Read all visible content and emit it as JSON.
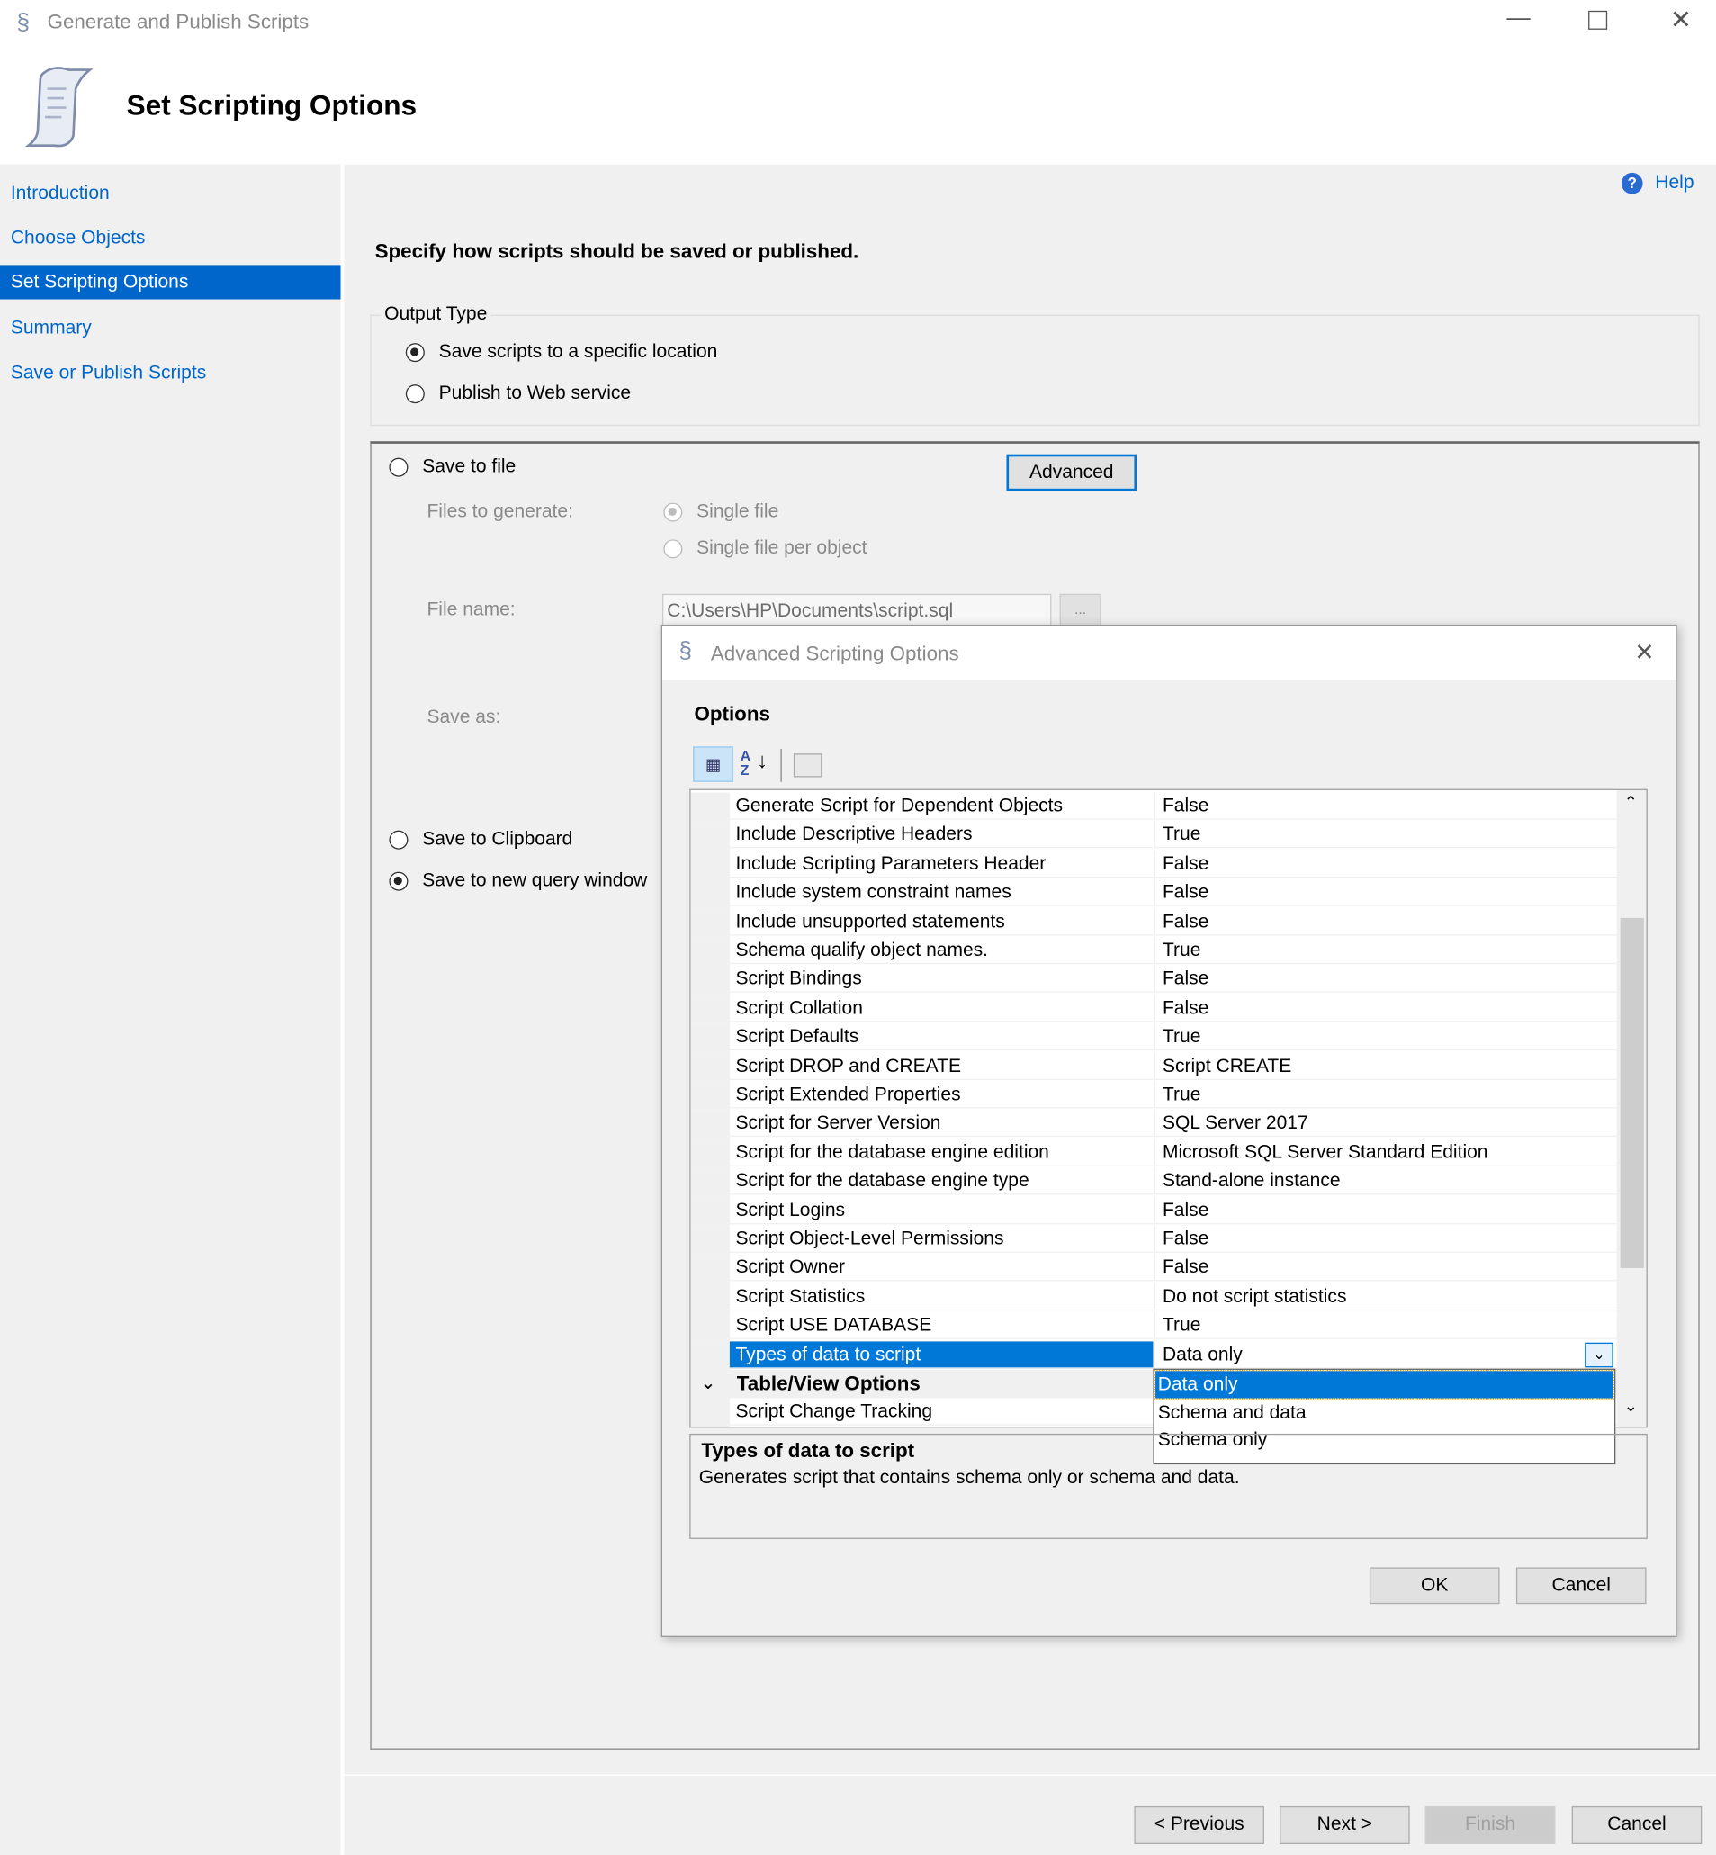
{
  "window": {
    "title": "Generate and Publish Scripts"
  },
  "header": {
    "title": "Set Scripting Options"
  },
  "sidebar": {
    "items": [
      {
        "label": "Introduction"
      },
      {
        "label": "Choose Objects"
      },
      {
        "label": "Set Scripting Options",
        "selected": true
      },
      {
        "label": "Summary"
      },
      {
        "label": "Save or Publish Scripts"
      }
    ]
  },
  "help": "Help",
  "instruction": "Specify how scripts should be saved or published.",
  "output_type": {
    "label": "Output Type",
    "options": [
      "Save scripts to a specific location",
      "Publish to Web service"
    ],
    "selected": 0
  },
  "save": {
    "save_to_file": "Save to file",
    "advanced": "Advanced",
    "files_label": "Files to generate:",
    "single_file": "Single file",
    "per_object": "Single file per object",
    "file_name_label": "File name:",
    "file_name": "C:\\Users\\HP\\Documents\\script.sql",
    "browse": "...",
    "save_as_label": "Save as:",
    "clipboard": "Save to Clipboard",
    "query_window": "Save to new query window",
    "selected": "query_window"
  },
  "dialog": {
    "title": "Advanced Scripting Options",
    "options_label": "Options",
    "rows": [
      {
        "name": "Generate Script for Dependent Objects",
        "value": "False"
      },
      {
        "name": "Include Descriptive Headers",
        "value": "True"
      },
      {
        "name": "Include Scripting Parameters Header",
        "value": "False"
      },
      {
        "name": "Include system constraint names",
        "value": "False"
      },
      {
        "name": "Include unsupported statements",
        "value": "False"
      },
      {
        "name": "Schema qualify object names.",
        "value": "True"
      },
      {
        "name": "Script Bindings",
        "value": "False"
      },
      {
        "name": "Script Collation",
        "value": "False"
      },
      {
        "name": "Script Defaults",
        "value": "True"
      },
      {
        "name": "Script DROP and CREATE",
        "value": "Script CREATE"
      },
      {
        "name": "Script Extended Properties",
        "value": "True"
      },
      {
        "name": "Script for Server Version",
        "value": "SQL Server 2017"
      },
      {
        "name": "Script for the database engine edition",
        "value": "Microsoft SQL Server Standard Edition"
      },
      {
        "name": "Script for the database engine type",
        "value": "Stand-alone instance"
      },
      {
        "name": "Script Logins",
        "value": "False"
      },
      {
        "name": "Script Object-Level Permissions",
        "value": "False"
      },
      {
        "name": "Script Owner",
        "value": "False"
      },
      {
        "name": "Script Statistics",
        "value": "Do not script statistics"
      },
      {
        "name": "Script USE DATABASE",
        "value": "True"
      },
      {
        "name": "Types of data to script",
        "value": "Data only",
        "selected": true
      }
    ],
    "category": "Table/View Options",
    "after_rows": [
      {
        "name": "Script Change Tracking",
        "value": ""
      }
    ],
    "dropdown": {
      "options": [
        "Data only",
        "Schema and data",
        "Schema only"
      ],
      "selected": 0
    },
    "description": {
      "title": "Types of data to script",
      "text": "Generates script that contains schema only or schema and data."
    },
    "ok": "OK",
    "cancel": "Cancel"
  },
  "footer": {
    "previous": "< Previous",
    "next": "Next >",
    "finish": "Finish",
    "cancel": "Cancel"
  },
  "colors": {
    "accent": "#0066cc",
    "selection": "#0078d7"
  }
}
